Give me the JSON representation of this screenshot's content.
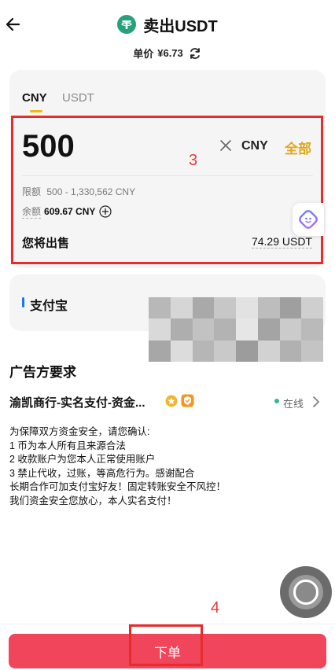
{
  "header": {
    "title": "卖出USDT",
    "price_label": "单价",
    "price_value": "¥6.73"
  },
  "tabs": [
    {
      "label": "CNY",
      "active": true
    },
    {
      "label": "USDT",
      "active": false
    }
  ],
  "input": {
    "amount": "500",
    "unit": "CNY",
    "all_label": "全部",
    "limit_label": "限额",
    "limit_value": "500 - 1,330,562 CNY",
    "balance_label": "余额",
    "balance_value": "609.67 CNY",
    "sell_label": "您将出售",
    "sell_value": "74.29 USDT"
  },
  "payment": {
    "method_label": "支付宝"
  },
  "advertiser": {
    "section_title": "广告方要求",
    "merchant_name": "渝凯商行-实名支付-资金...",
    "status": "在线",
    "terms": [
      "为保障双方资金安全，请您确认:",
      "1 币为本人所有且来源合法",
      "2 收款账户为您本人正常使用账户",
      "3 禁止代收，过账，等高危行为。感谢配合",
      "长期合作可加支付宝好友！固定转账安全不风控！",
      "我们资金安全您放心，本人实名支付！"
    ]
  },
  "annotations": {
    "label_3": "3",
    "label_4": "4"
  },
  "footer": {
    "order_button": "下单"
  },
  "colors": {
    "accent": "#f0b90b",
    "all_button": "#e0a81a",
    "order_button": "#f0455a",
    "annotation": "#e62c2c",
    "online": "#2ebd85",
    "tether": "#26a17b"
  },
  "icons": [
    "back-arrow-icon",
    "tether-logo-icon",
    "refresh-icon",
    "clear-icon",
    "plus-circle-icon",
    "ai-assistant-icon",
    "verified-badge-icon",
    "merchant-badge-icon",
    "chevron-right-icon",
    "floating-assist-icon"
  ]
}
